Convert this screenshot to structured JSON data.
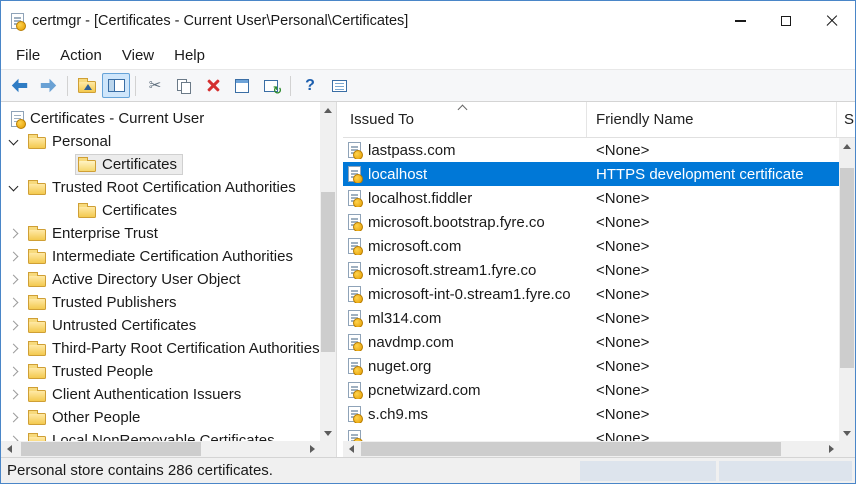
{
  "window": {
    "title": "certmgr - [Certificates - Current User\\Personal\\Certificates]"
  },
  "menu": {
    "items": [
      {
        "label": "File"
      },
      {
        "label": "Action"
      },
      {
        "label": "View"
      },
      {
        "label": "Help"
      }
    ]
  },
  "toolbar": {
    "icons": [
      {
        "name": "back-icon"
      },
      {
        "name": "forward-icon"
      },
      {
        "name": "up-one-level-icon"
      },
      {
        "name": "show-hide-console-tree-icon",
        "pressed": true
      },
      {
        "name": "cut-icon"
      },
      {
        "name": "copy-icon"
      },
      {
        "name": "delete-icon"
      },
      {
        "name": "properties-icon"
      },
      {
        "name": "refresh-icon"
      },
      {
        "name": "help-icon"
      },
      {
        "name": "export-list-icon"
      }
    ]
  },
  "tree": {
    "root_label": "Certificates - Current User",
    "items": [
      {
        "label": "Personal",
        "state": "expanded"
      },
      {
        "label": "Certificates",
        "child": true,
        "selected": true
      },
      {
        "label": "Trusted Root Certification Authorities",
        "state": "expanded"
      },
      {
        "label": "Certificates",
        "child": true
      },
      {
        "label": "Enterprise Trust",
        "state": "collapsed"
      },
      {
        "label": "Intermediate Certification Authorities",
        "state": "collapsed"
      },
      {
        "label": "Active Directory User Object",
        "state": "collapsed"
      },
      {
        "label": "Trusted Publishers",
        "state": "collapsed"
      },
      {
        "label": "Untrusted Certificates",
        "state": "collapsed"
      },
      {
        "label": "Third-Party Root Certification Authorities",
        "state": "collapsed"
      },
      {
        "label": "Trusted People",
        "state": "collapsed"
      },
      {
        "label": "Client Authentication Issuers",
        "state": "collapsed"
      },
      {
        "label": "Other People",
        "state": "collapsed"
      },
      {
        "label": "Local NonRemovable Certificates",
        "state": "collapsed",
        "partial": true
      }
    ]
  },
  "list": {
    "columns": [
      {
        "label": "Issued To",
        "sorted": "ascending"
      },
      {
        "label": "Friendly Name"
      },
      {
        "label": "S"
      }
    ],
    "rows": [
      {
        "issued_to": "lastpass.com",
        "friendly_name": "<None>"
      },
      {
        "issued_to": "localhost",
        "friendly_name": "HTTPS development certificate",
        "selected": true
      },
      {
        "issued_to": "localhost.fiddler",
        "friendly_name": "<None>"
      },
      {
        "issued_to": "microsoft.bootstrap.fyre.co",
        "friendly_name": "<None>"
      },
      {
        "issued_to": "microsoft.com",
        "friendly_name": "<None>"
      },
      {
        "issued_to": "microsoft.stream1.fyre.co",
        "friendly_name": "<None>"
      },
      {
        "issued_to": "microsoft-int-0.stream1.fyre.co",
        "friendly_name": "<None>"
      },
      {
        "issued_to": "ml314.com",
        "friendly_name": "<None>"
      },
      {
        "issued_to": "navdmp.com",
        "friendly_name": "<None>"
      },
      {
        "issued_to": "nuget.org",
        "friendly_name": "<None>"
      },
      {
        "issued_to": "pcnetwizard.com",
        "friendly_name": "<None>"
      },
      {
        "issued_to": "s.ch9.ms",
        "friendly_name": "<None>"
      }
    ],
    "partial_row": {
      "issued_to": "",
      "friendly_name": "<None>"
    }
  },
  "status": {
    "text": "Personal store contains 286 certificates."
  },
  "colors": {
    "selection": "#0078d7",
    "window_border": "#4a86c8",
    "folder": "#f3c94f",
    "delete_red": "#d43030"
  }
}
